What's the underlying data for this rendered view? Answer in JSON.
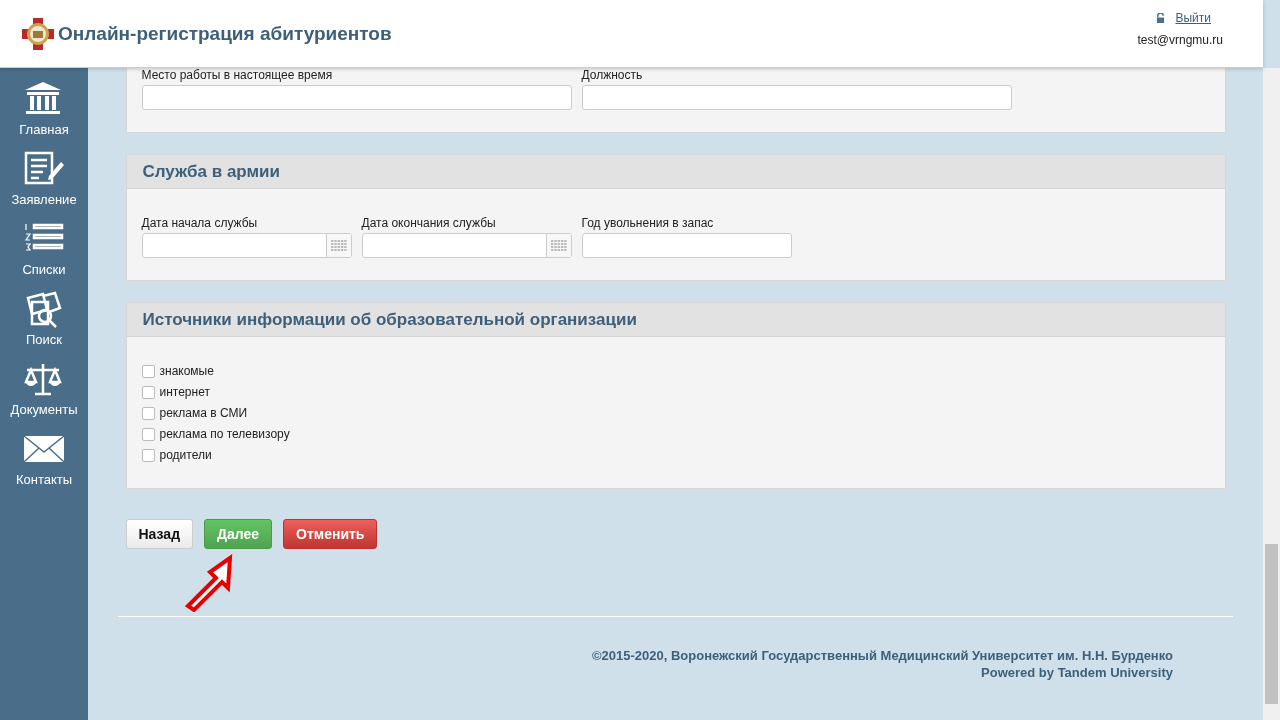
{
  "header": {
    "title": "Онлайн-регистрация абитуриентов",
    "logout": "Выйти",
    "email": "test@vrngmu.ru"
  },
  "sidebar": {
    "items": [
      {
        "label": "Главная",
        "kind": "home"
      },
      {
        "label": "Заявление",
        "kind": "form"
      },
      {
        "label": "Списки",
        "kind": "list"
      },
      {
        "label": "Поиск",
        "kind": "search"
      },
      {
        "label": "Документы",
        "kind": "scales"
      },
      {
        "label": "Контакты",
        "kind": "mail"
      }
    ]
  },
  "sections": [
    {
      "fields": [
        {
          "label": "Место работы в настоящее время",
          "kind": "text"
        },
        {
          "label": "Должность",
          "kind": "text"
        }
      ]
    },
    {
      "title": "Служба в армии",
      "fields": [
        {
          "label": "Дата начала службы",
          "kind": "date"
        },
        {
          "label": "Дата окончания службы",
          "kind": "date"
        },
        {
          "label": "Год увольнения в запас",
          "kind": "text"
        }
      ]
    },
    {
      "title": "Источники информации об образовательной организации",
      "checkboxes": [
        {
          "label": "знакомые",
          "checked": false
        },
        {
          "label": "интернет",
          "checked": false
        },
        {
          "label": "реклама в СМИ",
          "checked": false
        },
        {
          "label": "реклама по телевизору",
          "checked": false
        },
        {
          "label": "родители",
          "checked": false
        }
      ]
    }
  ],
  "buttons": [
    {
      "label": "Назад",
      "kind": "default"
    },
    {
      "label": "Далее",
      "kind": "success"
    },
    {
      "label": "Отменить",
      "kind": "danger"
    }
  ],
  "footer": {
    "copyright": "©2015-2020, Воронежский Государственный Медицинский Университет им. Н.Н. Бурденко",
    "powered": "Powered by Tandem University"
  }
}
